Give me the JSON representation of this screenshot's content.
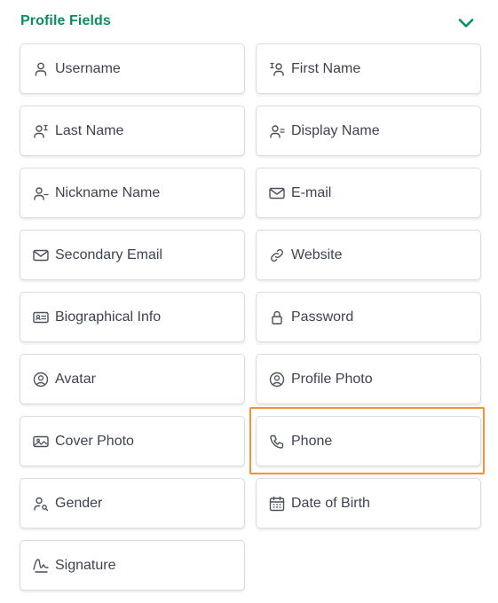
{
  "section": {
    "title": "Profile Fields",
    "collapse_icon": "chevron-down-icon",
    "accent_color": "#06905f"
  },
  "fields": [
    {
      "label": "Username",
      "icon": "user-icon"
    },
    {
      "label": "First Name",
      "icon": "user-first-name-icon"
    },
    {
      "label": "Last Name",
      "icon": "user-last-name-icon"
    },
    {
      "label": "Display Name",
      "icon": "user-display-name-icon"
    },
    {
      "label": "Nickname Name",
      "icon": "user-nickname-icon"
    },
    {
      "label": "E-mail",
      "icon": "mail-icon"
    },
    {
      "label": "Secondary Email",
      "icon": "mail-icon"
    },
    {
      "label": "Website",
      "icon": "link-icon"
    },
    {
      "label": "Biographical Info",
      "icon": "id-card-icon"
    },
    {
      "label": "Password",
      "icon": "lock-icon"
    },
    {
      "label": "Avatar",
      "icon": "user-circle-icon"
    },
    {
      "label": "Profile Photo",
      "icon": "user-circle-icon"
    },
    {
      "label": "Cover Photo",
      "icon": "photo-icon"
    },
    {
      "label": "Phone",
      "icon": "phone-icon"
    },
    {
      "label": "Gender",
      "icon": "user-search-icon"
    },
    {
      "label": "Date of Birth",
      "icon": "calendar-icon"
    },
    {
      "label": "Signature",
      "icon": "signature-icon"
    }
  ],
  "highlighted_field": "Phone",
  "highlight_color": "#f7922e"
}
